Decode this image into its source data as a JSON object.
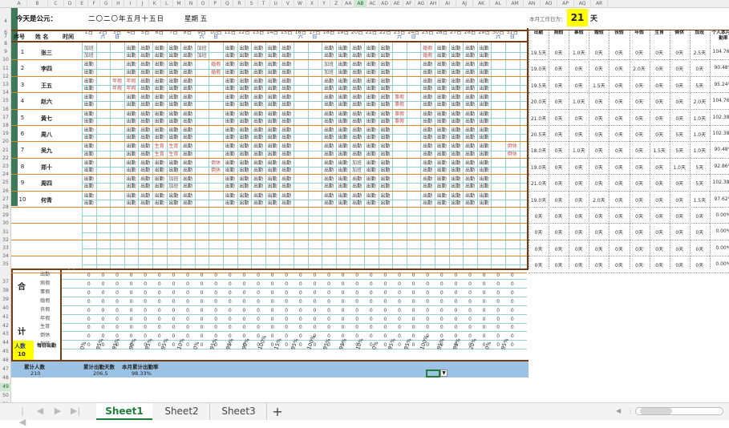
{
  "columns": [
    "A",
    "B",
    "C",
    "D",
    "E",
    "F",
    "G",
    "H",
    "I",
    "J",
    "K",
    "L",
    "M",
    "N",
    "O",
    "P",
    "Q",
    "R",
    "S",
    "T",
    "U",
    "V",
    "W",
    "X",
    "Y",
    "Z",
    "AA",
    "AB",
    "AC",
    "AD",
    "AE",
    "AF",
    "AG",
    "AH",
    "AI",
    "AJ",
    "AK",
    "AL",
    "AM",
    "AN",
    "AO",
    "AP",
    "AQ",
    "AR"
  ],
  "selected_column": "AB",
  "rows": [
    "4",
    "6",
    "7",
    "8",
    "9",
    "10",
    "11",
    "12",
    "13",
    "14",
    "15",
    "16",
    "17",
    "18",
    "19",
    "20",
    "21",
    "22",
    "23",
    "24",
    "25",
    "26",
    "27",
    "28",
    "29",
    "30",
    "31",
    "32",
    "33",
    "34",
    "35",
    "37",
    "38",
    "39",
    "40",
    "41",
    "42",
    "43",
    "44",
    "45",
    "46",
    "47",
    "48",
    "49",
    "50",
    "51"
  ],
  "selected_row": "49",
  "header": {
    "today_label": "今天是公元：",
    "date_text": "二〇二〇年五月十五日",
    "weekday_text": "星期  五",
    "workdays_label": "本月工作日为：",
    "workdays_value": "21",
    "workdays_unit": "天"
  },
  "table_headers": {
    "seq": "序号",
    "name": "姓  名",
    "period": "时间"
  },
  "calendar": {
    "days": [
      "1日",
      "2日",
      "3日",
      "4日",
      "5日",
      "6日",
      "7日",
      "8日",
      "9日",
      "10日",
      "11日",
      "12日",
      "13日",
      "14日",
      "15日",
      "16日",
      "17日",
      "18日",
      "19日",
      "20日",
      "21日",
      "22日",
      "23日",
      "24日",
      "25日",
      "26日",
      "27日",
      "28日",
      "29日",
      "30日",
      "31日"
    ],
    "weekdays": [
      "五",
      "六",
      "日",
      "一",
      "二",
      "三",
      "四",
      "五",
      "六",
      "日",
      "一",
      "二",
      "三",
      "四",
      "五",
      "六",
      "日",
      "一",
      "二",
      "三",
      "四",
      "五",
      "六",
      "日",
      "一",
      "二",
      "三",
      "四",
      "五",
      "六",
      "日"
    ]
  },
  "employees": [
    {
      "no": "1",
      "name": "张三"
    },
    {
      "no": "2",
      "name": "李四"
    },
    {
      "no": "3",
      "name": "王五"
    },
    {
      "no": "4",
      "name": "赵六"
    },
    {
      "no": "5",
      "name": "黄七"
    },
    {
      "no": "6",
      "name": "周八"
    },
    {
      "no": "7",
      "name": "吴九"
    },
    {
      "no": "8",
      "name": "郑十"
    },
    {
      "no": "9",
      "name": "周四"
    },
    {
      "no": "10",
      "name": "何青"
    }
  ],
  "period_labels": {
    "am": "上午",
    "pm": "下午"
  },
  "summary_headers": [
    "出勤",
    "病假",
    "事假",
    "婚假",
    "丧假",
    "年假",
    "生育",
    "倒休",
    "加班",
    "个人本月出勤率"
  ],
  "summary_rows": [
    [
      "19.5天",
      "0天",
      "1.0天",
      "0天",
      "0天",
      "0天",
      "0天",
      "0天",
      "2.5天",
      "104.76%"
    ],
    [
      "19.0天",
      "0天",
      "0天",
      "0天",
      "0天",
      "2.0天",
      "0天",
      "0天",
      "0天",
      "90.48%"
    ],
    [
      "19.5天",
      "0天",
      "0天",
      "1.5天",
      "0天",
      "0天",
      "0天",
      "0天",
      "5天",
      "95.24%"
    ],
    [
      "20.0天",
      "0天",
      "1.0天",
      "0天",
      "0天",
      "0天",
      "0天",
      "0天",
      "2.0天",
      "104.76%"
    ],
    [
      "21.0天",
      "0天",
      "0天",
      "0天",
      "0天",
      "0天",
      "0天",
      "0天",
      "1.0天",
      "102.38%"
    ],
    [
      "20.5天",
      "0天",
      "0天",
      "0天",
      "0天",
      "0天",
      "0天",
      "5天",
      "1.0天",
      "102.38%"
    ],
    [
      "18.0天",
      "0天",
      "1.0天",
      "0天",
      "0天",
      "0天",
      "1.5天",
      "5天",
      "1.0天",
      "90.48%"
    ],
    [
      "19.0天",
      "0天",
      "0天",
      "0天",
      "0天",
      "0天",
      "0天",
      "1.0天",
      "5天",
      "92.86%"
    ],
    [
      "21.0天",
      "0天",
      "0天",
      "0天",
      "0天",
      "0天",
      "0天",
      "0天",
      "5天",
      "102.38%"
    ],
    [
      "19.0天",
      "0天",
      "0天",
      "2.0天",
      "0天",
      "0天",
      "0天",
      "0天",
      "1.5天",
      "97.62%"
    ],
    [
      "0天",
      "0天",
      "0天",
      "0天",
      "0天",
      "0天",
      "0天",
      "0天",
      "0天",
      "0.00%"
    ],
    [
      "0天",
      "0天",
      "0天",
      "0天",
      "0天",
      "0天",
      "0天",
      "0天",
      "0天",
      "0.00%"
    ],
    [
      "0天",
      "0天",
      "0天",
      "0天",
      "0天",
      "0天",
      "0天",
      "0天",
      "0天",
      "0.00%"
    ],
    [
      "0天",
      "0天",
      "0天",
      "0天",
      "0天",
      "0天",
      "0天",
      "0天",
      "0天",
      "0.00%"
    ]
  ],
  "cell_words": {
    "present": "出勤",
    "overtime": "加班",
    "annual": "年假",
    "marriage": "婚假",
    "personal": "事假",
    "birth": "生育",
    "rest": "倒休"
  },
  "totals": {
    "section_he": "合",
    "section_ji": "计",
    "categories": [
      "出勤",
      "病假",
      "事假",
      "婚假",
      "丧假",
      "年假",
      "生育",
      "倒休",
      "加班"
    ],
    "people_label": "人数",
    "people_value": "10",
    "daily_rate_label": "每日出勤",
    "daily_rates": [
      "0%",
      "95%",
      "95%",
      "90%",
      "95%",
      "95%",
      "10%",
      "0%",
      "95%",
      "95%",
      "90%",
      "100%",
      "15%",
      "95%",
      "100%",
      "95%",
      "95%",
      "10%",
      "0%",
      "95%",
      "95%",
      "100%",
      "95%",
      "95%",
      "20%",
      "0%",
      "95%"
    ]
  },
  "footer": {
    "total_people_label": "累计人数",
    "total_people_value": "210",
    "total_days_label": "累计出勤天数",
    "total_days_value": "206.5",
    "rate_label": "本月累计出勤率",
    "rate_value": "98.33%"
  },
  "sheets": [
    "Sheet1",
    "Sheet2",
    "Sheet3"
  ],
  "active_sheet": "Sheet1",
  "colors": {
    "accent": "#1e7e3a",
    "gridline": "#8fd3d3",
    "border": "#7a3b12",
    "footer_band": "#9cc2e5",
    "highlight": "#ffff00"
  }
}
